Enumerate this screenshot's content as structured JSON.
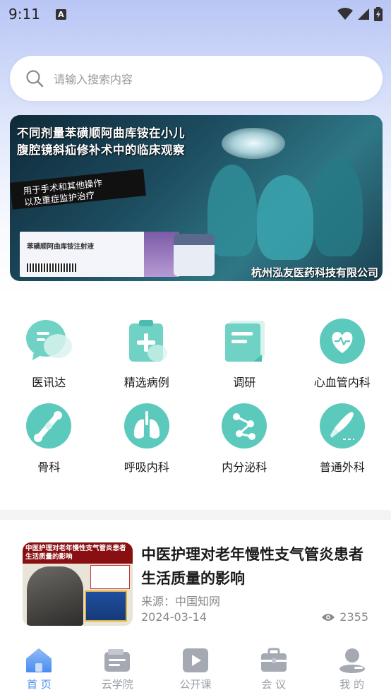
{
  "status_bar": {
    "time": "9:11",
    "notification_glyph": "A"
  },
  "search": {
    "placeholder": "请输入搜索内容"
  },
  "banner": {
    "title_line1": "不同剂量苯磺顺阿曲库铵在小儿",
    "title_line2": "腹腔镜斜疝修补术中的临床观察",
    "sub_line1": "用于手术和其他操作",
    "sub_line2": "以及重症监护治疗",
    "product_name": "苯磺顺阿曲库铵注射液",
    "company": "杭州泓友医药科技有限公司"
  },
  "categories": [
    {
      "label": "医讯达",
      "icon": "chat-bubble-icon"
    },
    {
      "label": "精选病例",
      "icon": "clipboard-plus-icon"
    },
    {
      "label": "调研",
      "icon": "survey-doc-icon"
    },
    {
      "label": "心血管内科",
      "icon": "heart-icon"
    },
    {
      "label": "骨科",
      "icon": "bone-icon"
    },
    {
      "label": "呼吸内科",
      "icon": "lungs-icon"
    },
    {
      "label": "内分泌科",
      "icon": "molecule-icon"
    },
    {
      "label": "普通外科",
      "icon": "scalpel-icon"
    }
  ],
  "article": {
    "title": "中医护理对老年慢性支气管炎患者生活质量的影响",
    "source": "来源：中国知网",
    "date": "2024-03-14",
    "views": "2355",
    "thumb_text": "中医护理对老年慢性支气管炎患者生活质量的影响"
  },
  "tabbar": [
    {
      "label": "首 页",
      "icon": "home-icon",
      "active": true
    },
    {
      "label": "云学院",
      "icon": "wallet-icon",
      "active": false
    },
    {
      "label": "公开课",
      "icon": "play-icon",
      "active": false
    },
    {
      "label": "会 议",
      "icon": "briefcase-icon",
      "active": false
    },
    {
      "label": "我 的",
      "icon": "user-icon",
      "active": false
    }
  ],
  "colors": {
    "accent": "#4a8ef0",
    "teal": "#5cc9bd",
    "inactive": "#9aa0a8"
  }
}
